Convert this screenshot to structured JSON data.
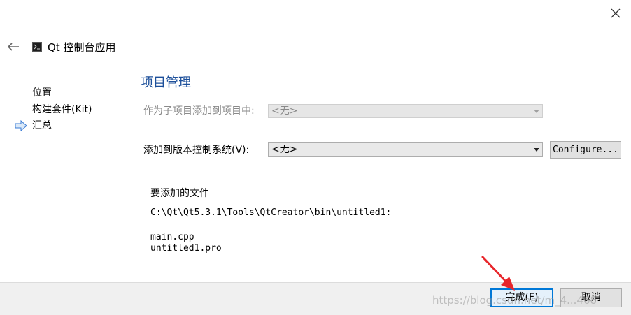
{
  "window": {
    "title": "Qt 控制台应用",
    "icons": {
      "close": "close-icon",
      "back": "back-arrow-icon",
      "app": "terminal-icon"
    }
  },
  "steps": {
    "items": [
      "位置",
      "构建套件(Kit)",
      "汇总"
    ],
    "current_index": 2,
    "current_indicator_icon": "arrow-right-icon"
  },
  "page": {
    "title": "项目管理",
    "add_to_project_label": "作为子项目添加到项目中:",
    "add_to_project_value": "<无>",
    "vcs_label": "添加到版本控制系统(V):",
    "vcs_value": "<无>",
    "configure_label": "Configure...",
    "files_heading": "要添加的文件",
    "files_path": "C:\\Qt\\Qt5.3.1\\Tools\\QtCreator\\bin\\untitled1:",
    "files": [
      "main.cpp",
      "untitled1.pro"
    ]
  },
  "footer": {
    "finish_label": "完成(F)",
    "cancel_label": "取消"
  },
  "colors": {
    "title_blue": "#1c4f9a",
    "focus_blue": "#0078d7",
    "annotation_red": "#e8262b"
  },
  "watermark": "https://blog.csdn.net/m_4...468"
}
